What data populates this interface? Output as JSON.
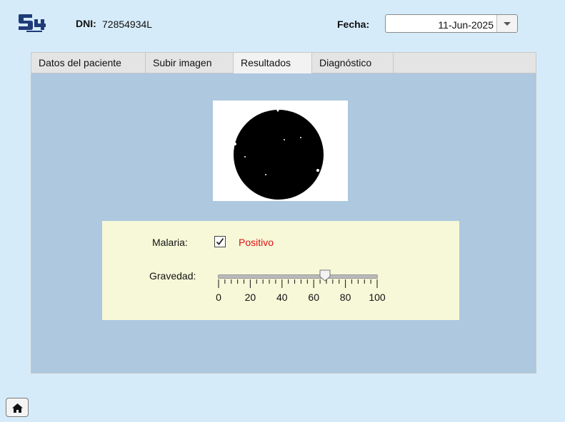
{
  "header": {
    "dni_label": "DNI:",
    "dni_value": "72854934L",
    "fecha_label": "Fecha:",
    "fecha_value": "11-Jun-2025"
  },
  "tabs": [
    {
      "label": "Datos del paciente",
      "active": false
    },
    {
      "label": "Subir imagen",
      "active": false
    },
    {
      "label": "Resultados",
      "active": true
    },
    {
      "label": "Diagnóstico",
      "active": false
    }
  ],
  "results": {
    "malaria_label": "Malaria:",
    "malaria_checked": true,
    "malaria_result": "Positivo",
    "gravedad_label": "Gravedad:",
    "gravedad_value": 67,
    "scale_min": 0,
    "scale_max": 100,
    "scale_labels": [
      "0",
      "20",
      "40",
      "60",
      "80",
      "100"
    ]
  },
  "colors": {
    "background": "#d6ebf9",
    "panel": "#adc8df",
    "results_box": "#f6f8d8",
    "positive_text": "#e01010",
    "logo": "#1f3b78"
  },
  "icons": {
    "logo": "s4-logo-icon",
    "date_dropdown": "chevron-down-icon",
    "checkbox": "check-icon",
    "home": "home-icon"
  }
}
